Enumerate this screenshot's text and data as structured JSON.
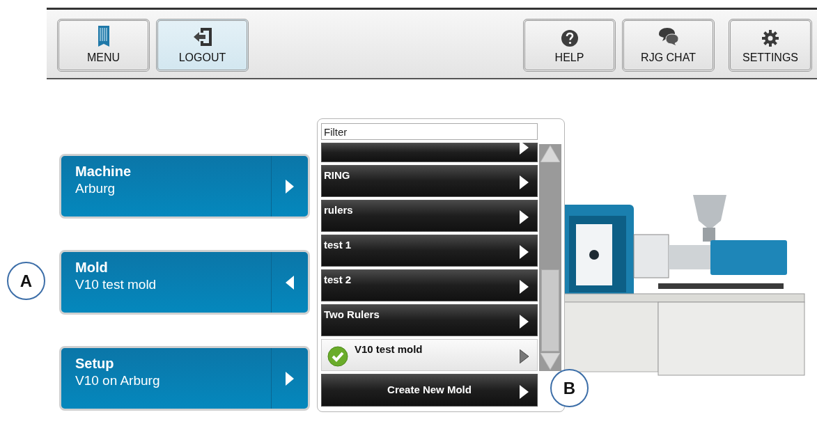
{
  "toolbar": {
    "buttons": [
      {
        "kind": "menu",
        "label": "MENU",
        "highlighted": false
      },
      {
        "kind": "logout",
        "label": "LOGOUT",
        "highlighted": true
      },
      {
        "kind": "help",
        "label": "HELP",
        "highlighted": false
      },
      {
        "kind": "chat",
        "label": "RJG CHAT",
        "highlighted": false
      },
      {
        "kind": "settings",
        "label": "SETTINGS",
        "highlighted": false
      }
    ]
  },
  "steps": [
    {
      "title": "Machine",
      "value": "Arburg",
      "expanded": false
    },
    {
      "title": "Mold",
      "value": "V10 test mold",
      "expanded": true
    },
    {
      "title": "Setup",
      "value": "V10 on Arburg",
      "expanded": false
    }
  ],
  "mold_picker": {
    "filter": {
      "placeholder": "Filter"
    },
    "items": [
      {
        "selected": false
      },
      {
        "name": "RING",
        "selected": false
      },
      {
        "name": "rulers",
        "selected": false
      },
      {
        "name": "test 1",
        "selected": false
      },
      {
        "name": "test 2",
        "selected": false
      },
      {
        "name": "Two Rulers",
        "selected": false
      },
      {
        "name": "V10 test mold",
        "selected": true
      }
    ],
    "create_button": "Create New Mold"
  },
  "callouts": [
    {
      "label": "A"
    },
    {
      "label": "B"
    }
  ]
}
